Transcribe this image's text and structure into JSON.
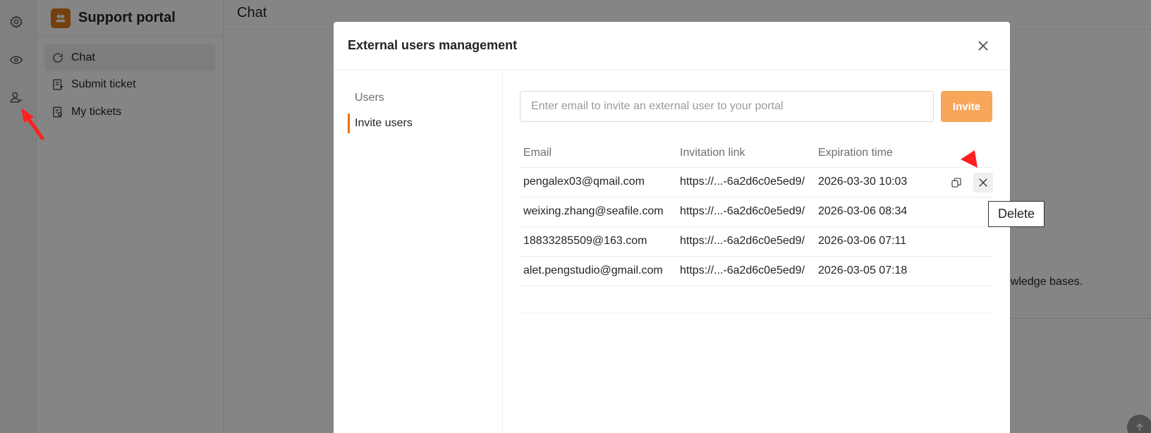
{
  "sidebar": {
    "title": "Support portal",
    "items": [
      {
        "label": "Chat",
        "icon": "chat-icon"
      },
      {
        "label": "Submit ticket",
        "icon": "submit-ticket-icon"
      },
      {
        "label": "My tickets",
        "icon": "my-tickets-icon"
      }
    ]
  },
  "rail": {
    "icons": [
      "settings-icon",
      "eye-icon",
      "external-users-icon"
    ]
  },
  "main": {
    "title": "Chat",
    "partial_text": "owledge bases."
  },
  "modal": {
    "title": "External users management",
    "nav": [
      {
        "label": "Users",
        "active": false
      },
      {
        "label": "Invite users",
        "active": true
      }
    ],
    "invite": {
      "placeholder": "Enter email to invite an external user to your portal",
      "button_label": "Invite"
    },
    "table": {
      "headers": {
        "email": "Email",
        "link": "Invitation link",
        "expiration": "Expiration time"
      },
      "rows": [
        {
          "email": "pengalex03@qmail.com",
          "link": "https://...-6a2d6c0e5ed9/",
          "expiration": "2026-03-30 10:03"
        },
        {
          "email": "weixing.zhang@seafile.com",
          "link": "https://...-6a2d6c0e5ed9/",
          "expiration": "2026-03-06 08:34"
        },
        {
          "email": "18833285509@163.com",
          "link": "https://...-6a2d6c0e5ed9/",
          "expiration": "2026-03-06 07:11"
        },
        {
          "email": "alet.pengstudio@gmail.com",
          "link": "https://...-6a2d6c0e5ed9/",
          "expiration": "2026-03-05 07:18"
        }
      ]
    },
    "tooltip": "Delete"
  },
  "colors": {
    "accent": "#ed7109",
    "invite_button": "#f7a65a",
    "logo": "#e07b1a",
    "annotation_arrow": "#ff2020"
  }
}
